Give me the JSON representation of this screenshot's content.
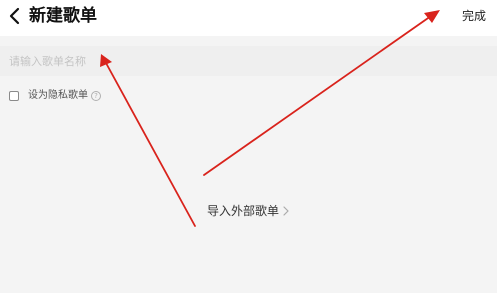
{
  "header": {
    "back_icon": "chevron-left-icon",
    "title": "新建歌单",
    "done_label": "完成"
  },
  "form": {
    "name_placeholder": "请输入歌单名称",
    "name_value": "",
    "private_label": "设为隐私歌单",
    "private_checked": false,
    "help_icon": "question-circle-icon",
    "help_glyph": "?"
  },
  "import": {
    "label": "导入外部歌单",
    "chevron_icon": "chevron-right-icon"
  },
  "annotation": {
    "arrow_color": "#d9231c"
  }
}
